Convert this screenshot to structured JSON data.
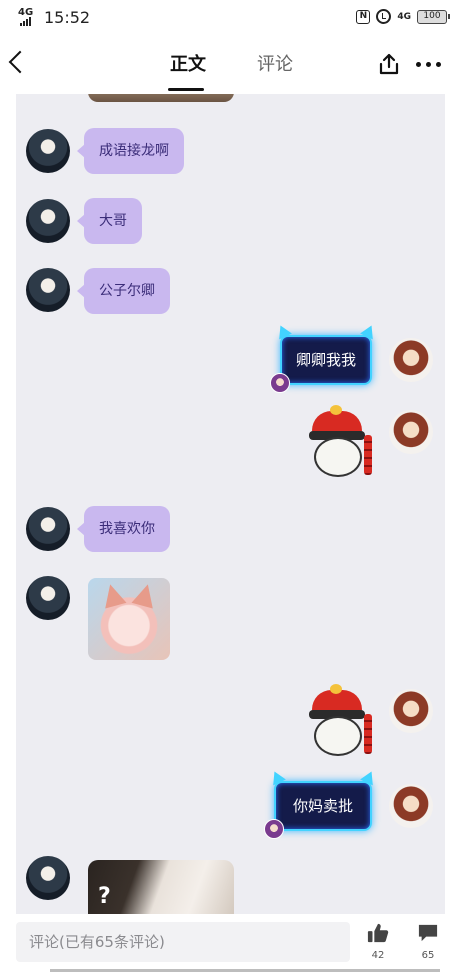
{
  "status": {
    "network": "4G",
    "time": "15:52",
    "nfc": "N",
    "network_right": "4G",
    "battery": "100"
  },
  "nav": {
    "tabs": [
      "正文",
      "评论"
    ],
    "active_tab": "正文"
  },
  "chat": {
    "messages": [
      {
        "side": "left",
        "type": "text",
        "text": "成语接龙啊"
      },
      {
        "side": "left",
        "type": "text",
        "text": "大哥"
      },
      {
        "side": "left",
        "type": "text",
        "text": "公子尔卿"
      },
      {
        "side": "right",
        "type": "neon-text",
        "text": "卿卿我我"
      },
      {
        "side": "right",
        "type": "sticker",
        "icon": "emoji-hat-sticker"
      },
      {
        "side": "left",
        "type": "text",
        "text": "我喜欢你"
      },
      {
        "side": "left",
        "type": "image",
        "icon": "cat-photo"
      },
      {
        "side": "right",
        "type": "sticker",
        "icon": "emoji-hat-sticker"
      },
      {
        "side": "right",
        "type": "neon-text",
        "text": "你妈卖批"
      },
      {
        "side": "left",
        "type": "image",
        "icon": "cat-photo-question",
        "overlay": "?"
      }
    ]
  },
  "bottom": {
    "comment_placeholder": "评论(已有65条评论)",
    "like_count": "42",
    "comment_count": "65"
  },
  "colors": {
    "chat_background": "#ededf2",
    "bubble_left": "#c9b8ef",
    "bubble_text": "#3b2d79",
    "neon_border": "#42d3ff"
  }
}
